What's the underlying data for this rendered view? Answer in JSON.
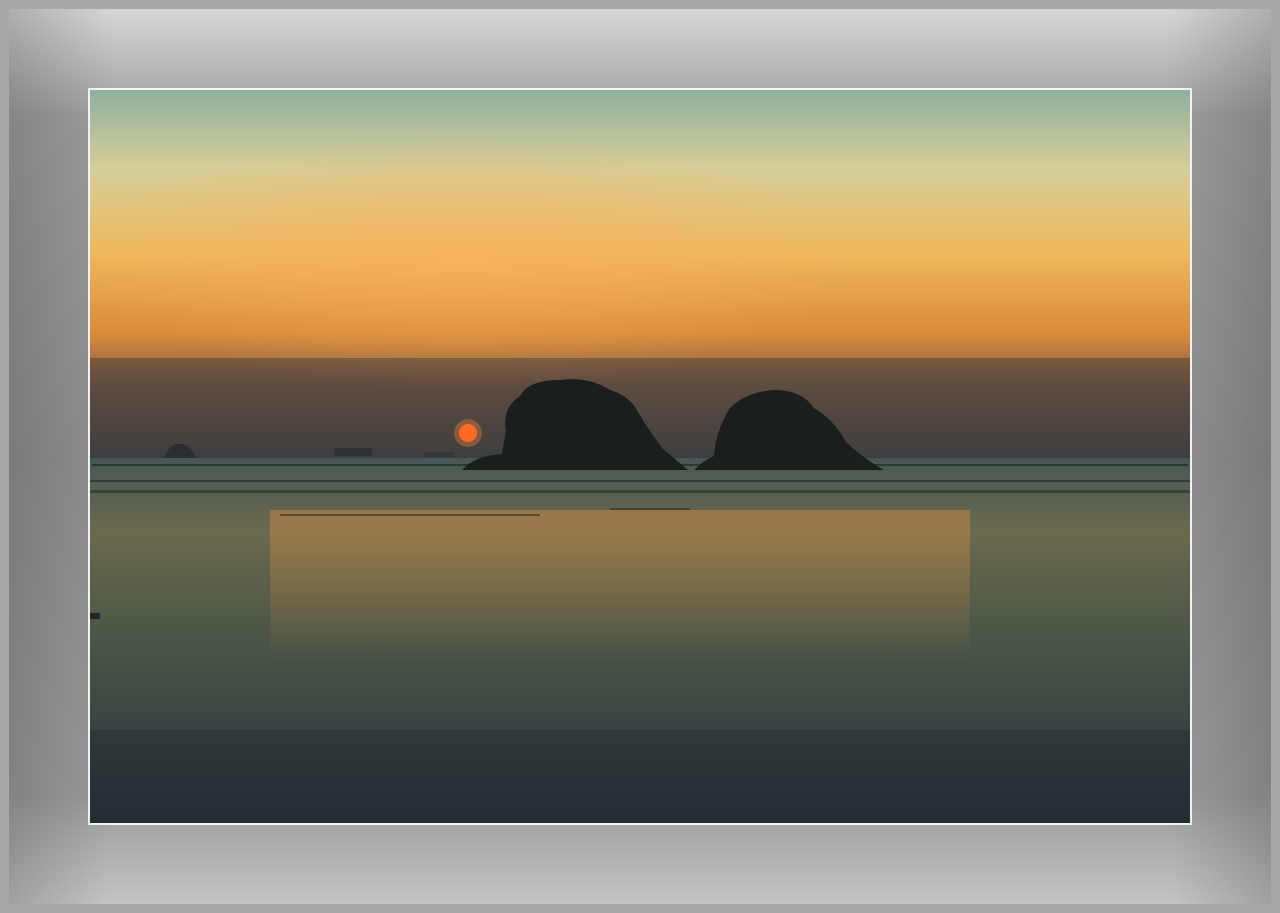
{
  "image": {
    "subject": "",
    "colors": {
      "sky_top": "#8fb0a0",
      "sky_mid": "#e9c67a",
      "sky_glow": "#e99a3a",
      "haze": "#4d4a4a",
      "sun": "#ff5a1a",
      "sea_top": "#3c4c4e",
      "sea_bottom": "#2c3438",
      "silhouette": "#1a1e1c",
      "frame": "#9a9a9a"
    },
    "icons": [
      "sun-icon",
      "island-left-icon",
      "island-right-icon"
    ]
  }
}
